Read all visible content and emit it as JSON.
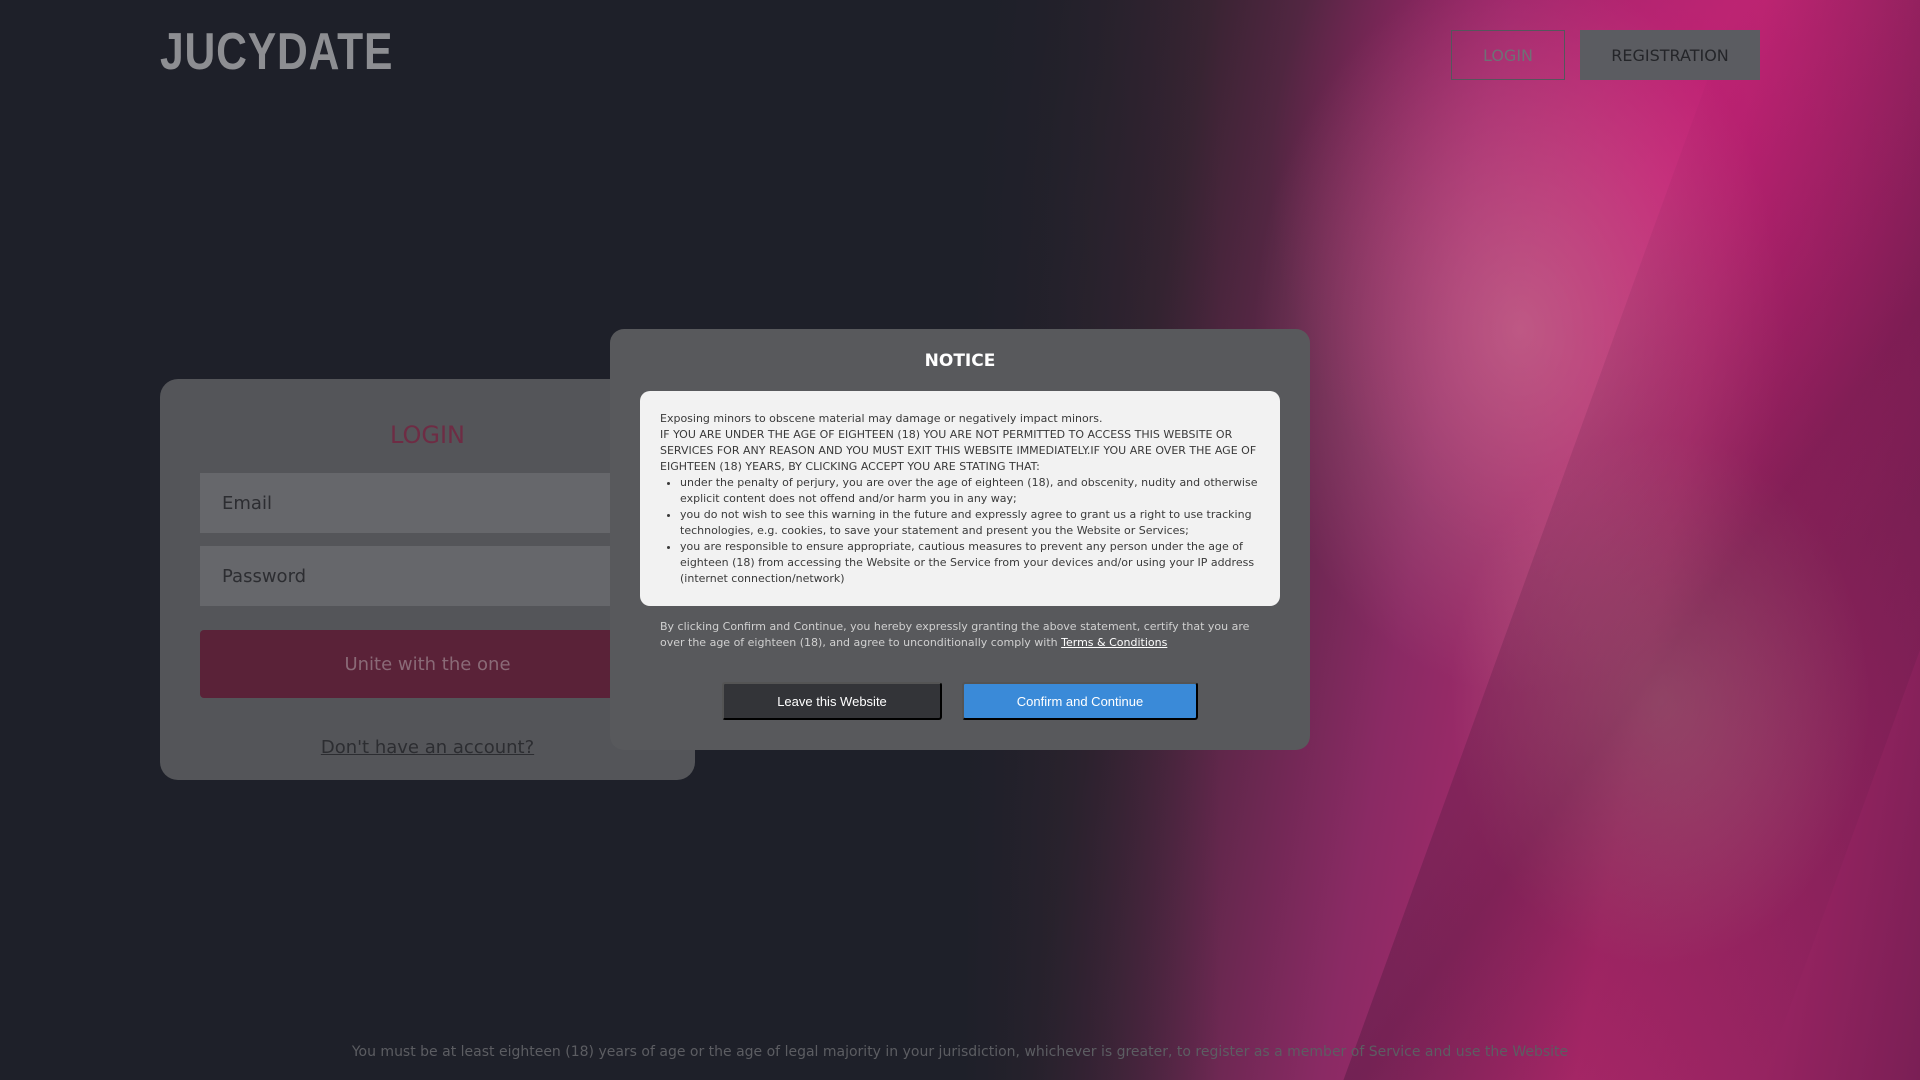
{
  "header": {
    "logo": "JUCYDATE",
    "login_label": "LOGIN",
    "registration_label": "REGISTRATION"
  },
  "login_card": {
    "title": "LOGIN",
    "email_placeholder": "Email",
    "password_placeholder": "Password",
    "submit_label": "Unite with the one",
    "no_account_link": "Don't have an account?"
  },
  "notice": {
    "title": "NOTICE",
    "intro_line": "Exposing minors to obscene material may damage or negatively impact minors.",
    "warning": "IF YOU ARE UNDER THE AGE OF EIGHTEEN (18) YOU ARE NOT PERMITTED TO ACCESS THIS WEBSITE OR SERVICES FOR ANY REASON AND YOU MUST EXIT THIS WEBSITE IMMEDIATELY.IF YOU ARE OVER THE AGE OF EIGHTEEN (18) YEARS, BY CLICKING ACCEPT YOU ARE STATING THAT:",
    "items": [
      "under the penalty of perjury, you are over the age of eighteen (18), and obscenity, nudity and otherwise explicit content does not offend and/or harm you in any way;",
      "you do not wish to see this warning in the future and expressly agree to grant us a right to use tracking technologies, e.g. cookies, to save your statement and present you the Website or Services;",
      "you are responsible to ensure appropriate, cautious measures to prevent any person under the age of eighteen (18) from accessing the Website or the Service from your devices and/or using your IP address (internet connection/network)"
    ],
    "footer_text": "By clicking Confirm and Continue, you hereby expressly granting the above statement, certify that you are over the age of eighteen (18), and agree to unconditionally comply with",
    "terms_link": "Terms & Conditions",
    "leave_label": "Leave this Website",
    "confirm_label": "Confirm and Continue"
  },
  "footer": {
    "note": "You must be at least eighteen (18) years of age or the age of legal majority in your jurisdiction, whichever is greater, to register as a member of Service and use the Website"
  }
}
